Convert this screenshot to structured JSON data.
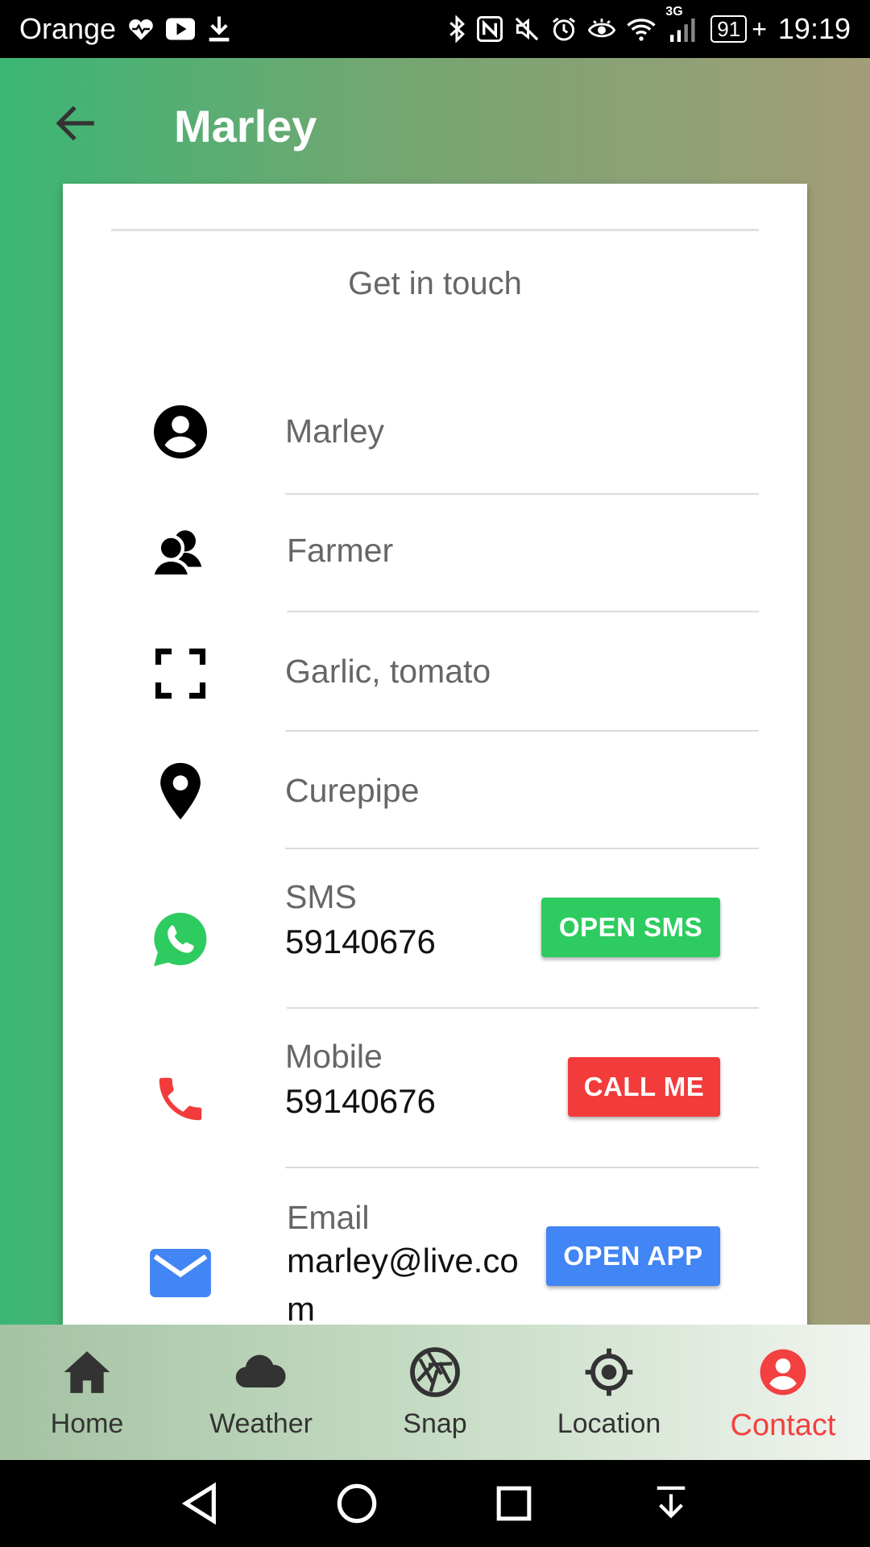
{
  "status_bar": {
    "carrier": "Orange",
    "network": "3G",
    "battery": "91",
    "time": "19:19"
  },
  "app_bar": {
    "title": "Marley"
  },
  "card": {
    "heading": "Get in touch",
    "name": "Marley",
    "occupation": "Farmer",
    "products": "Garlic, tomato",
    "location": "Curepipe",
    "sms": {
      "label": "SMS",
      "value": "59140676",
      "button": "OPEN SMS"
    },
    "mobile": {
      "label": "Mobile",
      "value": "59140676",
      "button": "CALL ME"
    },
    "email": {
      "label": "Email",
      "value": "marley@live.com",
      "button": "OPEN APP"
    }
  },
  "bottom_nav": {
    "items": [
      {
        "label": "Home",
        "icon": "home-icon"
      },
      {
        "label": "Weather",
        "icon": "cloud-icon"
      },
      {
        "label": "Snap",
        "icon": "camera-aperture-icon"
      },
      {
        "label": "Location",
        "icon": "crosshair-icon"
      },
      {
        "label": "Contact",
        "icon": "account-circle-icon"
      }
    ],
    "active": "Contact"
  },
  "colors": {
    "sms_button": "#2ecc60",
    "call_button": "#f23b3b",
    "app_button": "#4285f4",
    "active_nav": "#f34040",
    "whatsapp": "#2ecc60",
    "phone_icon": "#f23b3b",
    "mail_icon": "#4285f4"
  }
}
